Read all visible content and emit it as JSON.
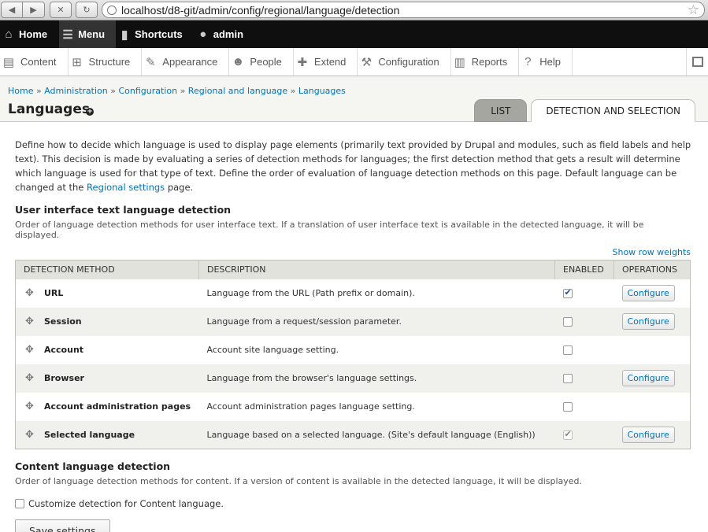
{
  "browser": {
    "url": "localhost/d8-git/admin/config/regional/language/detection"
  },
  "toolbar": {
    "home": "Home",
    "menu": "Menu",
    "shortcuts": "Shortcuts",
    "user": "admin"
  },
  "tray": {
    "items": [
      "Content",
      "Structure",
      "Appearance",
      "People",
      "Extend",
      "Configuration",
      "Reports",
      "Help"
    ]
  },
  "breadcrumb": {
    "items": [
      "Home",
      "Administration",
      "Configuration",
      "Regional and language",
      "Languages"
    ],
    "separator": "»"
  },
  "page": {
    "title": "Languages"
  },
  "tabs": {
    "list": "LIST",
    "detection": "DETECTION AND SELECTION"
  },
  "intro": {
    "text_before": "Define how to decide which language is used to display page elements (primarily text provided by Drupal and modules, such as field labels and help text). This decision is made by evaluating a series of detection methods for languages; the first detection method that gets a result will determine which language is used for that type of text. Define the order of evaluation of language detection methods on this page. Default language can be changed at the ",
    "link": "Regional settings",
    "text_after": " page."
  },
  "ui_section": {
    "title": "User interface text language detection",
    "description": "Order of language detection methods for user interface text. If a translation of user interface text is available in the detected language, it will be displayed.",
    "weights_link": "Show row weights"
  },
  "table": {
    "headers": [
      "DETECTION METHOD",
      "DESCRIPTION",
      "ENABLED",
      "OPERATIONS"
    ],
    "rows": [
      {
        "method": "URL",
        "description": "Language from the URL (Path prefix or domain).",
        "enabled": true,
        "disabled": false,
        "operation": "Configure"
      },
      {
        "method": "Session",
        "description": "Language from a request/session parameter.",
        "enabled": false,
        "disabled": false,
        "operation": "Configure"
      },
      {
        "method": "Account",
        "description": "Account site language setting.",
        "enabled": false,
        "disabled": false,
        "operation": ""
      },
      {
        "method": "Browser",
        "description": "Language from the browser's language settings.",
        "enabled": false,
        "disabled": false,
        "operation": "Configure"
      },
      {
        "method": "Account administration pages",
        "description": "Account administration pages language setting.",
        "enabled": false,
        "disabled": false,
        "operation": ""
      },
      {
        "method": "Selected language",
        "description": "Language based on a selected language. (Site's default language (English))",
        "enabled": true,
        "disabled": true,
        "operation": "Configure"
      }
    ]
  },
  "content_section": {
    "title": "Content language detection",
    "description": "Order of language detection methods for content. If a version of content is available in the detected language, it will be displayed.",
    "customize_label": "Customize detection for Content language."
  },
  "actions": {
    "save": "Save settings"
  }
}
